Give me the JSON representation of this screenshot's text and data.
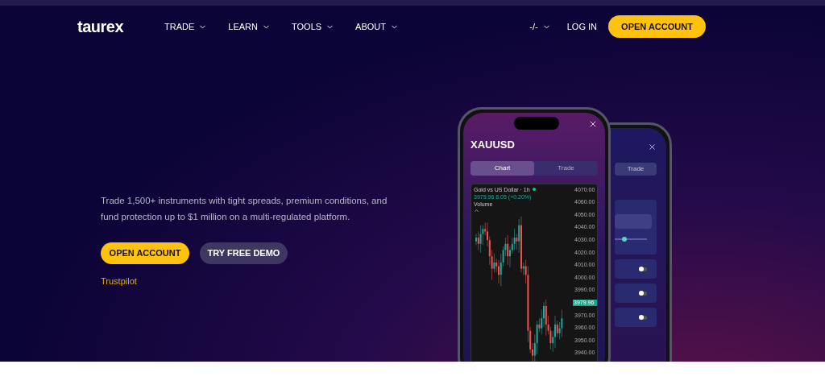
{
  "logo": "taurex",
  "nav": [
    {
      "label": "TRADE"
    },
    {
      "label": "LEARN"
    },
    {
      "label": "TOOLS"
    },
    {
      "label": "ABOUT"
    }
  ],
  "language": "-/-",
  "login": "LOG IN",
  "cta": "OPEN ACCOUNT",
  "hero": {
    "description": "Trade 1,500+ instruments with tight spreads, premium conditions, and fund protection up to $1 million on a multi-regulated platform.",
    "buttons": [
      {
        "label": "OPEN ACCOUNT",
        "kind": "primary"
      },
      {
        "label": "TRY FREE DEMO",
        "kind": "secondary"
      }
    ],
    "trustpilot": "Trustpilot"
  },
  "phone": {
    "symbol": "XAUUSD",
    "tabs": [
      {
        "label": "Chart",
        "selected": true
      },
      {
        "label": "Trade",
        "selected": false
      }
    ],
    "chart": {
      "title": "Gold vs US Dollar · 1h",
      "quote": "3979.96 8.05 (+0.20%)",
      "volume_label": "Volume",
      "price_ticks": [
        {
          "label": "4070.00",
          "kind": "tick"
        },
        {
          "label": "4060.00",
          "kind": "tick"
        },
        {
          "label": "4050.00",
          "kind": "tick"
        },
        {
          "label": "4040.00",
          "kind": "tick"
        },
        {
          "label": "4030.00",
          "kind": "tick"
        },
        {
          "label": "4020.00",
          "kind": "tick"
        },
        {
          "label": "4010.00",
          "kind": "tick"
        },
        {
          "label": "4000.00",
          "kind": "tick"
        },
        {
          "label": "3990.00",
          "kind": "tick"
        },
        {
          "label": "3979.96",
          "kind": "current"
        },
        {
          "label": "3970.00",
          "kind": "tick"
        },
        {
          "label": "3960.00",
          "kind": "tick"
        },
        {
          "label": "3950.00",
          "kind": "tick"
        },
        {
          "label": "3940.00",
          "kind": "tick"
        }
      ]
    }
  },
  "back_phone": {
    "tabs": [
      {
        "label": "Trade",
        "selected": false
      }
    ],
    "slider": {
      "level": 0.3
    },
    "toggles": [
      {
        "on": false
      },
      {
        "on": false
      },
      {
        "on": false
      }
    ]
  }
}
